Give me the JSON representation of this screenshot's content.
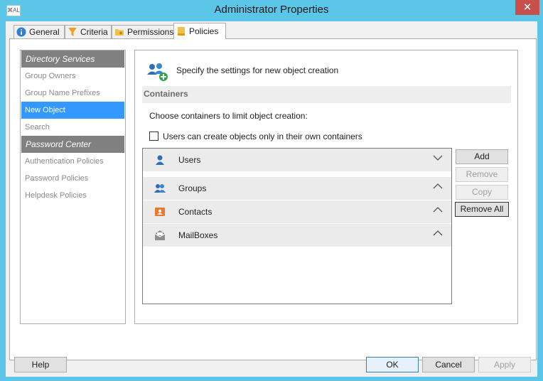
{
  "window": {
    "title": "Administrator Properties",
    "app_icon_text": "⌘AL",
    "close_glyph": "✕"
  },
  "tabs": [
    {
      "label": "General",
      "icon": "info-icon"
    },
    {
      "label": "Criteria",
      "icon": "filter-icon"
    },
    {
      "label": "Permissions",
      "icon": "folder-key-icon"
    },
    {
      "label": "Policies",
      "icon": "policy-book-icon",
      "active": true
    }
  ],
  "nav": {
    "section1": "Directory Services",
    "items1": [
      "Group Owners",
      "Group Name Prefixes",
      "New Object",
      "Search"
    ],
    "section2": "Password Center",
    "items2": [
      "Authentication Policies",
      "Password Policies",
      "Helpdesk Policies"
    ],
    "selected": "New Object"
  },
  "content": {
    "header": "Specify the settings for new object creation",
    "section_title": "Containers",
    "choose_label": "Choose containers to limit object creation:",
    "checkbox_label": "Users can create objects only in their own containers",
    "checkbox_checked": false
  },
  "containers": [
    {
      "label": "Users",
      "icon": "user-icon",
      "expanded": false
    },
    {
      "label": "Groups",
      "icon": "group-icon",
      "expanded": true
    },
    {
      "label": "Contacts",
      "icon": "contact-card-icon",
      "expanded": true
    },
    {
      "label": "MailBoxes",
      "icon": "mailbox-icon",
      "expanded": true
    }
  ],
  "side_buttons": {
    "add": "Add",
    "remove": "Remove",
    "copy": "Copy",
    "remove_all": "Remove All"
  },
  "footer": {
    "help": "Help",
    "ok": "OK",
    "cancel": "Cancel",
    "apply": "Apply"
  },
  "colors": {
    "window_frame": "#5bc6e8",
    "selection": "#3399ff",
    "nav_header": "#808080",
    "close": "#c7504a"
  }
}
